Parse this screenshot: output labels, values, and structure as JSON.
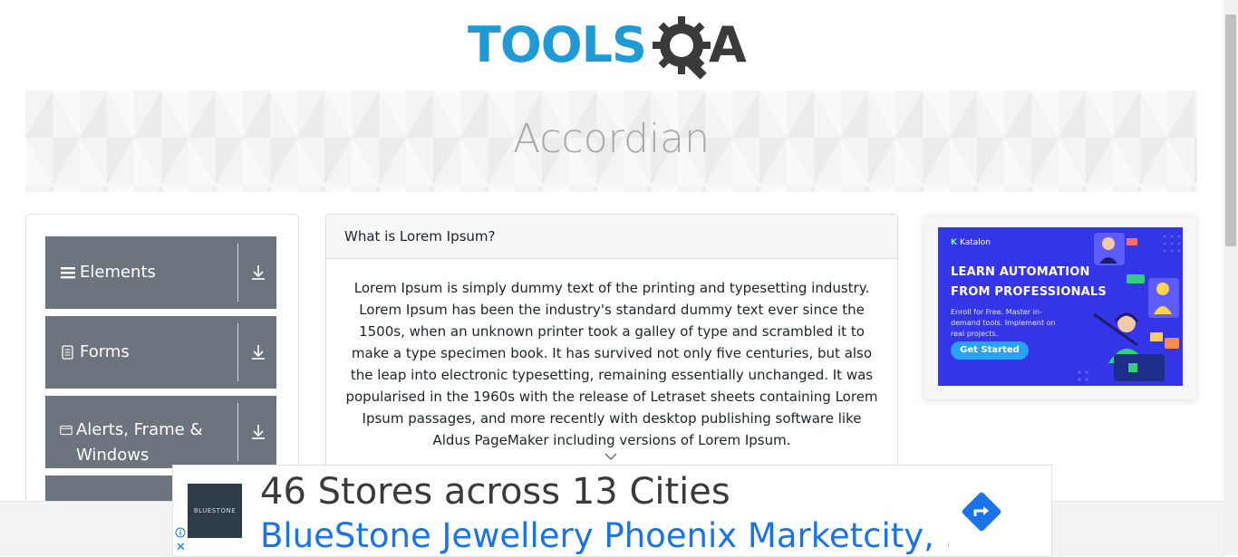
{
  "logo": {
    "word": "TOOLS",
    "letter": "A",
    "colors": {
      "tools": "#1f9ad6",
      "qa": "#3a3a3a"
    }
  },
  "banner": {
    "title": "Accordian"
  },
  "left_menu": {
    "groups": [
      {
        "label": "Elements",
        "icon": "hamburger-icon"
      },
      {
        "label": "Forms",
        "icon": "document-icon"
      },
      {
        "label": "Alerts, Frame & Windows",
        "icon": "window-icon"
      },
      {
        "label": "",
        "icon": ""
      }
    ],
    "expand_icon": "download-arrow-icon",
    "colors": {
      "group_bg": "#6c757d",
      "group_text": "#ffffff"
    }
  },
  "accordion": {
    "section1": {
      "heading": "What is Lorem Ipsum?",
      "body": "Lorem Ipsum is simply dummy text of the printing and typesetting industry. Lorem Ipsum has been the industry's standard dummy text ever since the 1500s, when an unknown printer took a galley of type and scrambled it to make a type specimen book. It has survived not only five centuries, but also the leap into electronic typesetting, remaining essentially unchanged. It was popularised in the 1960s with the release of Letraset sheets containing Lorem Ipsum passages, and more recently with desktop publishing software like Aldus PageMaker including versions of Lorem Ipsum."
    }
  },
  "side_ad": {
    "brand": "Katalon",
    "headline1": "LEARN AUTOMATION",
    "headline2": "FROM PROFESSIONALS",
    "subtext": "Enroll for Free. Master in-demand tools. Implement on real projects.",
    "button": "Get Started",
    "colors": {
      "bg": "#3535e8",
      "button": "#26a3ff"
    }
  },
  "bottom_ad": {
    "logo_text": "BLUESTONE",
    "title": "46 Stores across 13 Cities",
    "link": "BlueStone Jewellery Phoenix Marketcity, ...",
    "go_icon": "directions-icon",
    "choices_icon": "info-icon",
    "close_glyph": "✕",
    "colors": {
      "link": "#1a73e8",
      "title": "#3a3a3a"
    }
  }
}
